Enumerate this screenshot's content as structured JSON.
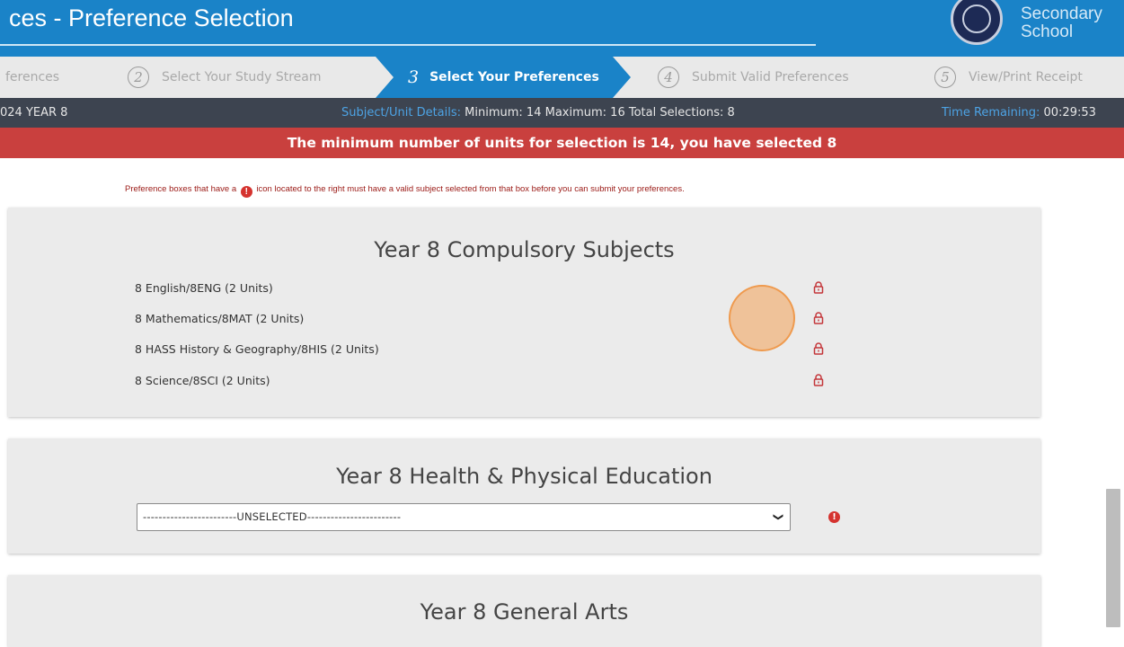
{
  "header": {
    "title": "ces - Preference Selection",
    "school_name_line1": "Secondary",
    "school_name_line2": "School",
    "logo_icon": "school-crest"
  },
  "steps": [
    {
      "label": "ferences"
    },
    {
      "number": "2",
      "label": "Select Your Study Stream"
    },
    {
      "number": "3",
      "label": "Select Your Preferences",
      "active": true
    },
    {
      "number": "4",
      "label": "Submit Valid Preferences"
    },
    {
      "number": "5",
      "label": "View/Print Receipt"
    }
  ],
  "infobar": {
    "left": "024 YEAR 8",
    "details_label": "Subject/Unit Details:",
    "details_value": "Minimum: 14 Maximum: 16 Total Selections: 8",
    "time_label": "Time Remaining:",
    "time_value": "00:29:53"
  },
  "alert": {
    "message": "The minimum number of units for selection is 14, you have selected 8"
  },
  "note": {
    "before": "Preference boxes that have a",
    "icon_char": "!",
    "after": "icon located to the right must have a valid subject selected from that box before you can submit your preferences."
  },
  "panels": {
    "compulsory": {
      "title": "Year 8 Compulsory Subjects",
      "subjects": [
        {
          "label": "8 English/8ENG (2 Units)",
          "icon": "lock-icon"
        },
        {
          "label": "8 Mathematics/8MAT (2 Units)",
          "icon": "lock-icon"
        },
        {
          "label": "8 HASS History & Geography/8HIS (2 Units)",
          "icon": "lock-icon"
        },
        {
          "label": "8 Science/8SCI (2 Units)",
          "icon": "lock-icon"
        }
      ]
    },
    "hpe": {
      "title": "Year 8 Health & Physical Education",
      "select_value": "------------------------UNSELECTED------------------------",
      "warning_char": "!"
    },
    "arts": {
      "title": "Year 8 General Arts"
    }
  },
  "colors": {
    "brand_blue": "#1a83c8",
    "info_bar": "#3d4450",
    "alert_red": "#c9403e",
    "lock_red": "#c4363a",
    "label_blue": "#4da3e4"
  }
}
